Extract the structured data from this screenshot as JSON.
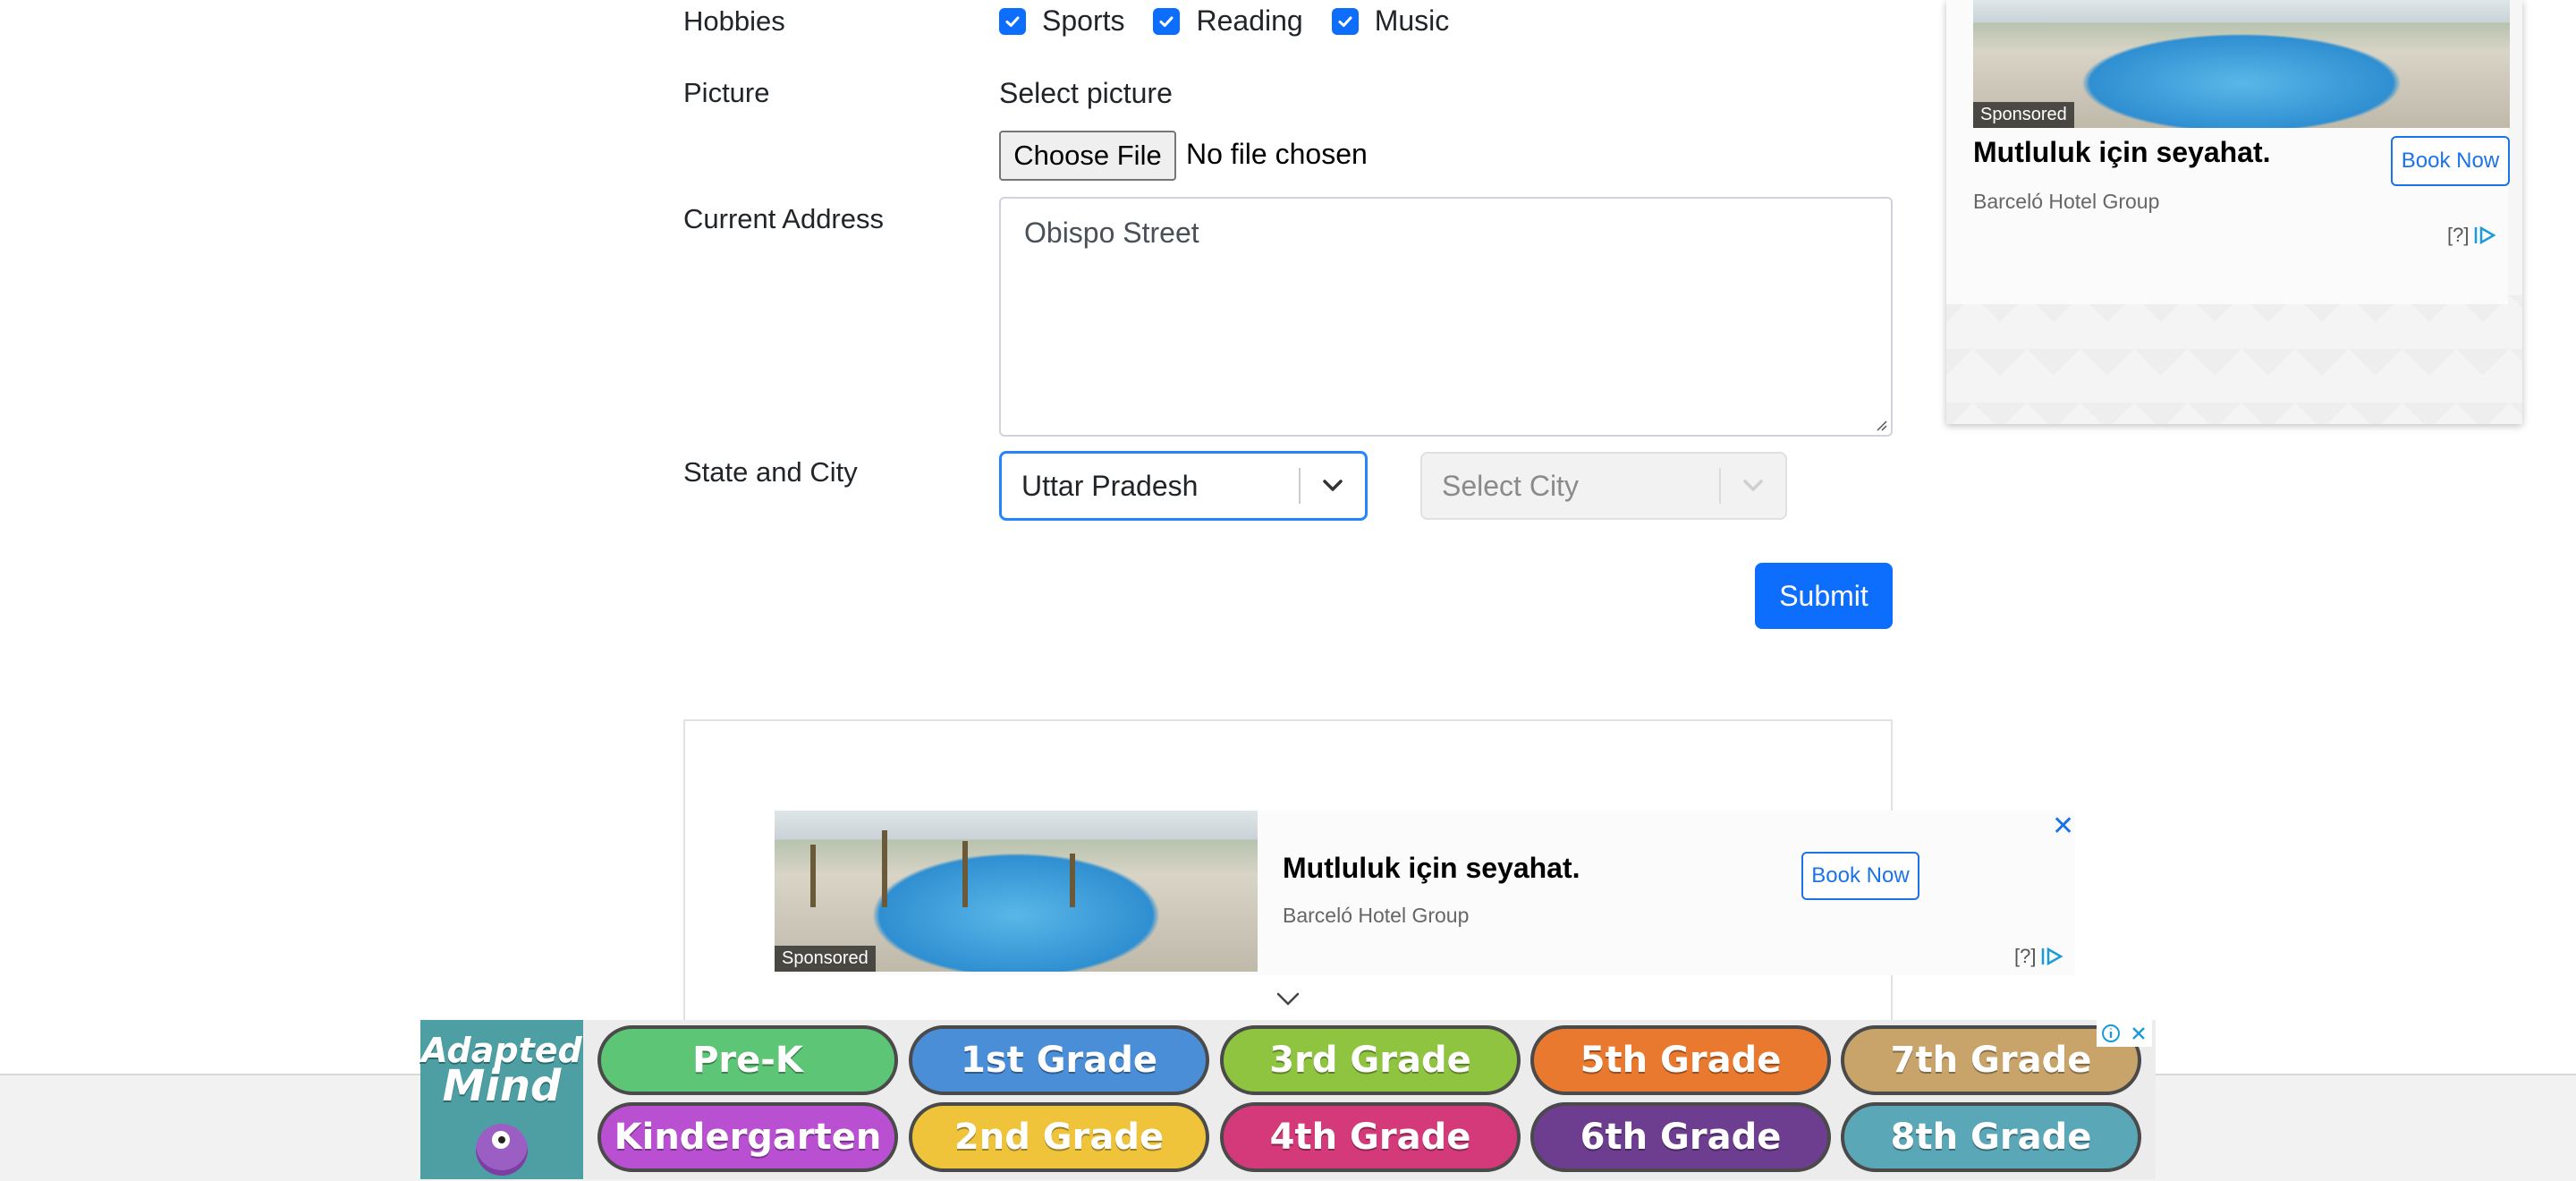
{
  "form": {
    "hobbies": {
      "label": "Hobbies",
      "options": [
        {
          "label": "Sports",
          "checked": true
        },
        {
          "label": "Reading",
          "checked": true
        },
        {
          "label": "Music",
          "checked": true
        }
      ]
    },
    "picture": {
      "label": "Picture",
      "heading": "Select picture",
      "button_label": "Choose File",
      "status": "No file chosen"
    },
    "address": {
      "label": "Current Address",
      "value": "Obispo Street"
    },
    "state_city": {
      "label": "State and City",
      "state_value": "Uttar Pradesh",
      "city_placeholder": "Select City"
    },
    "submit_label": "Submit"
  },
  "side_ad": {
    "sponsored": "Sponsored",
    "title": "Mutluluk için seyahat.",
    "advertiser": "Barceló Hotel Group",
    "button": "Book Now",
    "adchoices": "[?]"
  },
  "inline_ad": {
    "sponsored": "Sponsored",
    "title": "Mutluluk için seyahat.",
    "advertiser": "Barceló Hotel Group",
    "button": "Book Now",
    "adchoices": "[?]",
    "close": "✕"
  },
  "banner": {
    "logo_line1": "Adapted",
    "logo_line2": "Mind",
    "grades": [
      {
        "label": "Pre-K",
        "color": "#5cc576"
      },
      {
        "label": "1st Grade",
        "color": "#4a8ed8"
      },
      {
        "label": "3rd Grade",
        "color": "#8fc440"
      },
      {
        "label": "5th Grade",
        "color": "#e8792f"
      },
      {
        "label": "7th Grade",
        "color": "#c8a36a"
      },
      {
        "label": "Kindergarten",
        "color": "#b94fd1"
      },
      {
        "label": "2nd Grade",
        "color": "#efc43b"
      },
      {
        "label": "4th Grade",
        "color": "#d43a7a"
      },
      {
        "label": "6th Grade",
        "color": "#6d3d8f"
      },
      {
        "label": "8th Grade",
        "color": "#5aa7b8"
      }
    ]
  },
  "colors": {
    "primary": "#0d6efd",
    "ad_link": "#1a73e8"
  }
}
